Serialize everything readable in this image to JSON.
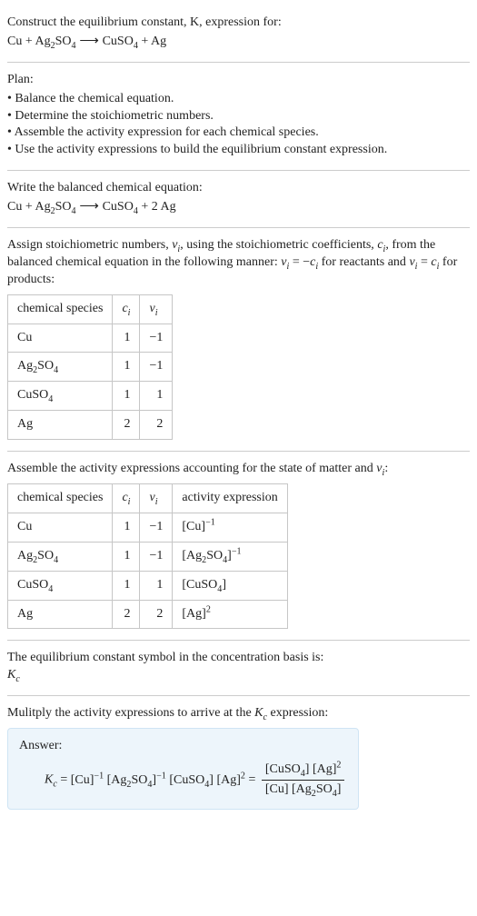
{
  "intro": {
    "line1": "Construct the equilibrium constant, K, expression for:",
    "equation_lhs": "Cu + Ag",
    "equation_sub_ag": "2",
    "equation_lhs2": "SO",
    "equation_sub_so": "4",
    "arrow": " ⟶ ",
    "equation_rhs1": "CuSO",
    "equation_sub_cuso": "4",
    "equation_rhs2": " + Ag"
  },
  "plan": {
    "heading": "Plan:",
    "items": [
      "Balance the chemical equation.",
      "Determine the stoichiometric numbers.",
      "Assemble the activity expression for each chemical species.",
      "Use the activity expressions to build the equilibrium constant expression."
    ]
  },
  "balanced": {
    "heading": "Write the balanced chemical equation:",
    "lhs1": "Cu + Ag",
    "sub_ag": "2",
    "lhs2": "SO",
    "sub_so": "4",
    "arrow": " ⟶ ",
    "rhs1": "CuSO",
    "sub_cuso": "4",
    "rhs2": " + 2 Ag"
  },
  "assign": {
    "text_a": "Assign stoichiometric numbers, ",
    "nu_i": "ν",
    "sub_i": "i",
    "text_b": ", using the stoichiometric coefficients, ",
    "c_i": "c",
    "text_c": ", from the balanced chemical equation in the following manner: ",
    "rel1_lhs": "ν",
    "rel1_eq": " = −",
    "rel1_rhs": "c",
    "text_d": " for reactants and ",
    "rel2_lhs": "ν",
    "rel2_eq": " = ",
    "rel2_rhs": "c",
    "text_e": " for products:"
  },
  "table1": {
    "headers": {
      "species": "chemical species",
      "c": "c",
      "nu": "ν",
      "sub": "i"
    },
    "rows": [
      {
        "species_html": "Cu",
        "c": "1",
        "nu": "−1"
      },
      {
        "species_html": "Ag2SO4",
        "c": "1",
        "nu": "−1"
      },
      {
        "species_html": "CuSO4",
        "c": "1",
        "nu": "1"
      },
      {
        "species_html": "Ag",
        "c": "2",
        "nu": "2"
      }
    ]
  },
  "assemble": {
    "text_a": "Assemble the activity expressions accounting for the state of matter and ",
    "nu": "ν",
    "sub": "i",
    "text_b": ":"
  },
  "table2": {
    "headers": {
      "species": "chemical species",
      "c": "c",
      "nu": "ν",
      "act": "activity expression",
      "sub": "i"
    }
  },
  "basis": {
    "line1": "The equilibrium constant symbol in the concentration basis is:",
    "symbol": "K",
    "sub": "c"
  },
  "multiply": {
    "text_a": "Mulitply the activity expressions to arrive at the ",
    "k": "K",
    "sub": "c",
    "text_b": " expression:"
  },
  "answer": {
    "label": "Answer:",
    "kc": "K",
    "kc_sub": "c",
    "eq": " = "
  },
  "chart_data": {
    "type": "table",
    "title": "Stoichiometric numbers and activity expressions",
    "tables": [
      {
        "columns": [
          "chemical species",
          "c_i",
          "ν_i"
        ],
        "rows": [
          [
            "Cu",
            1,
            -1
          ],
          [
            "Ag2SO4",
            1,
            -1
          ],
          [
            "CuSO4",
            1,
            1
          ],
          [
            "Ag",
            2,
            2
          ]
        ]
      },
      {
        "columns": [
          "chemical species",
          "c_i",
          "ν_i",
          "activity expression"
        ],
        "rows": [
          [
            "Cu",
            1,
            -1,
            "[Cu]^-1"
          ],
          [
            "Ag2SO4",
            1,
            -1,
            "[Ag2SO4]^-1"
          ],
          [
            "CuSO4",
            1,
            1,
            "[CuSO4]"
          ],
          [
            "Ag",
            2,
            2,
            "[Ag]^2"
          ]
        ]
      }
    ],
    "balanced_equation": "Cu + Ag2SO4 -> CuSO4 + 2 Ag",
    "Kc_expression": "Kc = [Cu]^-1 [Ag2SO4]^-1 [CuSO4] [Ag]^2 = ([CuSO4][Ag]^2) / ([Cu][Ag2SO4])"
  }
}
